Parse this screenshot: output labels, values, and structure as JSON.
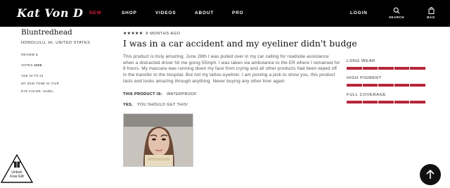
{
  "header": {
    "logo_text": "Kat Von D",
    "nav": [
      "NEW",
      "SHOP",
      "VIDEOS",
      "ABOUT",
      "PRO"
    ],
    "active_nav": "NEW",
    "login_label": "LOGIN",
    "search_label": "SEARCH",
    "bag_label": "BAG"
  },
  "reviewer": {
    "name": "Bluntredhead",
    "location": "HONOLULU, HI, UNITED STATES",
    "review_label": "REVIEW",
    "review_count": "1",
    "votes_label": "VOTES",
    "votes_count": "1025",
    "age": "AGE 18 TO 24",
    "skin_tone": "MY SKIN TONE IS: FAIR",
    "eye_color": "EYE COLOR: HAZEL"
  },
  "review": {
    "stars": "★★★★★",
    "rating": 5,
    "time_ago": "8 MONTHS AGO",
    "title": "I was in a car accident and my eyeliner didn't budge",
    "body": "This product is truly amazing. June 28th I was pulled over in my car calling for roadside assistance when a distracted driver hit me going 55mph. I was taken via ambulance to the ER where I remained for 8 hours. My mascara was running down my face from crying and all other products had been wiped off in the transfer to the hospital. But not my tattoo eyeliner. I am posting a pick to show you, this product lasts and looks amazing through anything. Never buying any other liner again",
    "product_is_label": "THIS PRODUCT IS:",
    "product_is_value": "WATERPROOF",
    "recommend_label": "YES,",
    "recommend_value": "YOU SHOULD GET THIS!"
  },
  "attributes": [
    {
      "label": "LONG WEAR",
      "level": 1.0
    },
    {
      "label": "HIGH PIGMENT",
      "level": 1.0
    },
    {
      "label": "FULL COVERAGE",
      "level": 1.0
    }
  ],
  "gift_badge": {
    "line1": "Unlock",
    "line2": "Free Gift"
  },
  "colors": {
    "accent": "#b7273a",
    "nav_active": "#e0203a",
    "header_bg": "#000000"
  }
}
